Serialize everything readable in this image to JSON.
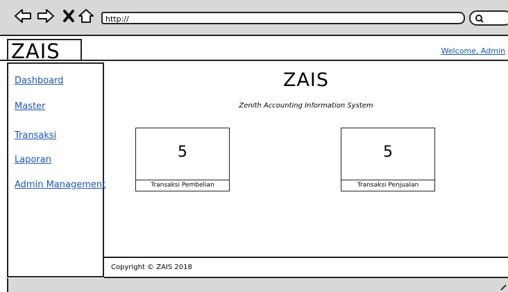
{
  "browser": {
    "url": "http://",
    "icons": [
      "back-arrow-icon",
      "forward-arrow-icon",
      "close-icon",
      "home-icon",
      "search-icon"
    ]
  },
  "header": {
    "logo": "ZAIS",
    "welcome": "Welcome, Admin"
  },
  "sidebar": {
    "items": [
      {
        "label": "Dashboard"
      },
      {
        "label": "Master"
      },
      {
        "label": "Transaksi"
      },
      {
        "label": "Laporan"
      },
      {
        "label": "Admin Management"
      }
    ]
  },
  "main": {
    "title": "ZAIS",
    "subtitle": "Zenith Accounting Information System",
    "cards": [
      {
        "value": "5",
        "label": "Transaksi Pembelian"
      },
      {
        "value": "5",
        "label": "Transaksi Penjualan"
      }
    ]
  },
  "footer": {
    "copyright": "Copyright © ZAIS 2018"
  },
  "colors": {
    "link": "#1a55b8",
    "chrome": "#d8d8d8"
  }
}
